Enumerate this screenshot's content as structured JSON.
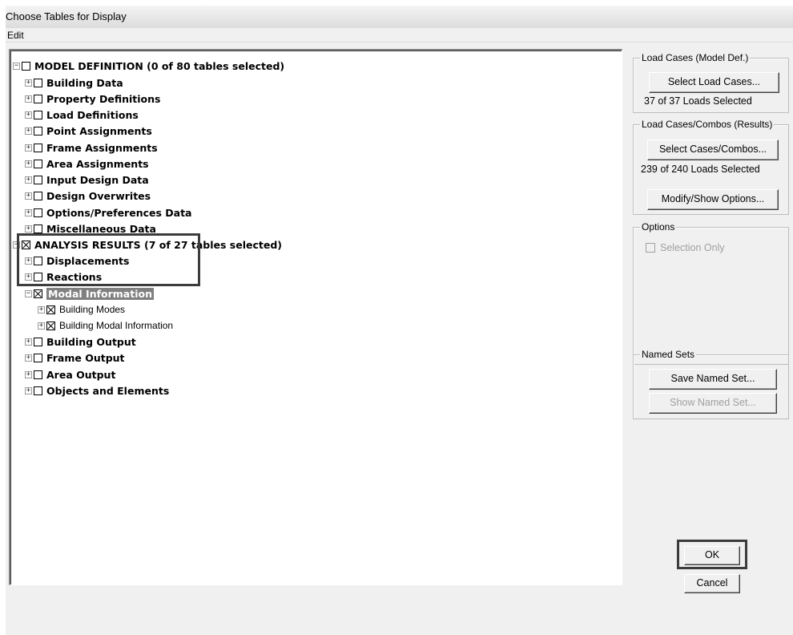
{
  "window": {
    "title": "Choose Tables for Display"
  },
  "menu": {
    "edit": "Edit"
  },
  "tree": {
    "model_definition": {
      "label": "MODEL DEFINITION  (0 of 80 tables selected)",
      "expand": "−",
      "checked": false,
      "children": [
        "Building Data",
        "Property Definitions",
        "Load Definitions",
        "Point Assignments",
        "Frame Assignments",
        "Area Assignments",
        "Input Design Data",
        "Design Overwrites",
        "Options/Preferences Data",
        "Miscellaneous Data"
      ]
    },
    "analysis_results": {
      "label": "ANALYSIS RESULTS  (7 of 27 tables selected)",
      "expand": "−",
      "checked": true,
      "children": {
        "displacements": "Displacements",
        "reactions": "Reactions",
        "modal_information": "Modal Information",
        "building_modes": "Building Modes",
        "building_modal_information": "Building Modal Information",
        "building_output": "Building Output",
        "frame_output": "Frame Output",
        "area_output": "Area Output",
        "objects_and_elements": "Objects and Elements"
      }
    },
    "plus_glyph": "+",
    "minus_glyph": "−"
  },
  "load_cases_model": {
    "title": "Load Cases (Model Def.)",
    "button": "Select Load Cases...",
    "status": "37  of  37  Loads Selected"
  },
  "load_cases_results": {
    "title": "Load Cases/Combos (Results)",
    "button": "Select Cases/Combos...",
    "status": "239  of  240  Loads Selected",
    "modify_button": "Modify/Show Options..."
  },
  "options": {
    "title": "Options",
    "selection_only": "Selection Only"
  },
  "named_sets": {
    "title": "Named Sets",
    "save_button": "Save Named Set...",
    "show_button": "Show Named Set..."
  },
  "actions": {
    "ok": "OK",
    "cancel": "Cancel"
  }
}
